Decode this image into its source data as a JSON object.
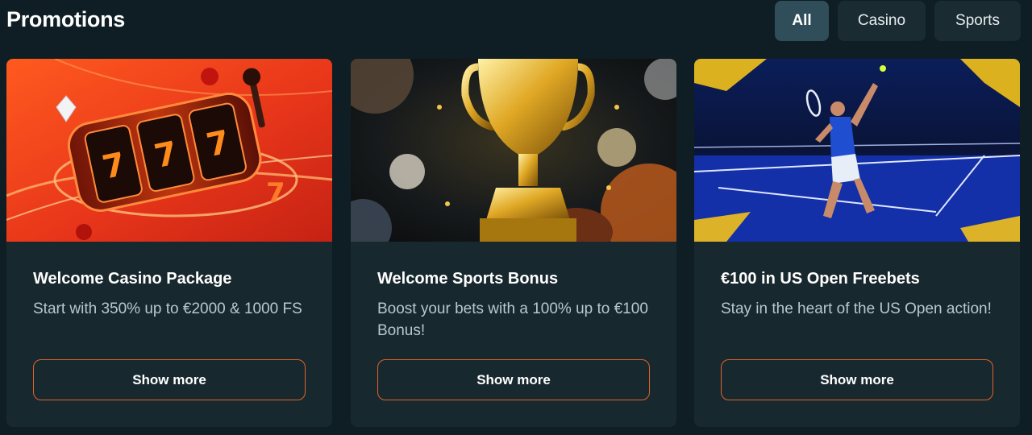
{
  "page_title": "Promotions",
  "filters": {
    "tabs": [
      {
        "label": "All",
        "active": true
      },
      {
        "label": "Casino",
        "active": false
      },
      {
        "label": "Sports",
        "active": false
      }
    ]
  },
  "colors": {
    "background": "#0e1e24",
    "card": "#18282f",
    "accent_border": "#e0622a",
    "tab_active": "#304e5a",
    "tab_inactive": "#1a2b32"
  },
  "promotions": [
    {
      "image": "slot-machine-illustration",
      "title": "Welcome Casino Package",
      "description": "Start with 350% up to €2000 & 1000 FS",
      "button_label": "Show more"
    },
    {
      "image": "golden-trophy-illustration",
      "title": "Welcome Sports Bonus",
      "description": "Boost your bets with a 100% up to €100 Bonus!",
      "button_label": "Show more"
    },
    {
      "image": "tennis-player-illustration",
      "title": "€100 in US Open Freebets",
      "description": "Stay in the heart of the US Open action!",
      "button_label": "Show more"
    }
  ]
}
